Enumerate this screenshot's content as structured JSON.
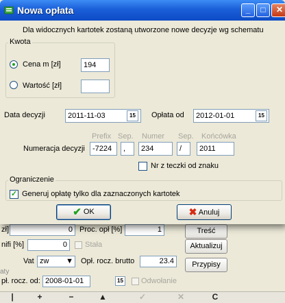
{
  "dialog": {
    "title": "Nowa opłata",
    "info": "Dla widocznych kartotek zostaną utworzone nowe decyzje wg schematu",
    "kwota": {
      "legend": "Kwota",
      "cena_label": "Cena m [zł]",
      "cena_value": "194",
      "wartosc_label": "Wartość [zł]",
      "wartosc_value": ""
    },
    "data_decyzji_label": "Data decyzji",
    "data_decyzji_value": "2011-11-03",
    "oplata_od_label": "Opłata od",
    "oplata_od_value": "2012-01-01",
    "numeracja": {
      "label": "Numeracja decyzji",
      "prefix_label": "Prefix",
      "prefix_value": "-7224",
      "sep1_label": "Sep.",
      "sep1_value": ",",
      "numer_label": "Numer",
      "numer_value": "234",
      "sep2_label": "Sep.",
      "sep2_value": "/",
      "koncowka_label": "Końcówka",
      "koncowka_value": "2011",
      "nr_z_teczki_label": "Nr z teczki od znaku"
    },
    "ograniczenie": {
      "legend": "Ograniczenie",
      "generuj_label": "Generuj opłatę tylko dla zaznaczonych kartotek"
    },
    "ok_label": "OK",
    "cancel_label": "Anuluj"
  },
  "background": {
    "row1_label_left": "zł]",
    "row1_value": "0",
    "proc_label": "Proc. opł [%]",
    "proc_value": "1",
    "tresc_label": "Treść",
    "bon_label": "nifi [%]",
    "bon_value": "0",
    "stala_label": "Stała",
    "aktualizuj_label": "Aktualizuj",
    "vat_label": "Vat",
    "vat_value": "zw",
    "brutto_label": "Opł. rocz. brutto",
    "brutto_value": "23.4",
    "przypisy_label": "Przypisy",
    "od_label": "pł. rocz. od:",
    "od_value": "2008-01-01",
    "odwolanie_label": "Odwołanie",
    "side_label": "aty",
    "nav": [
      "|",
      "+",
      "−",
      "▲",
      "✓",
      "✕",
      "C"
    ]
  }
}
